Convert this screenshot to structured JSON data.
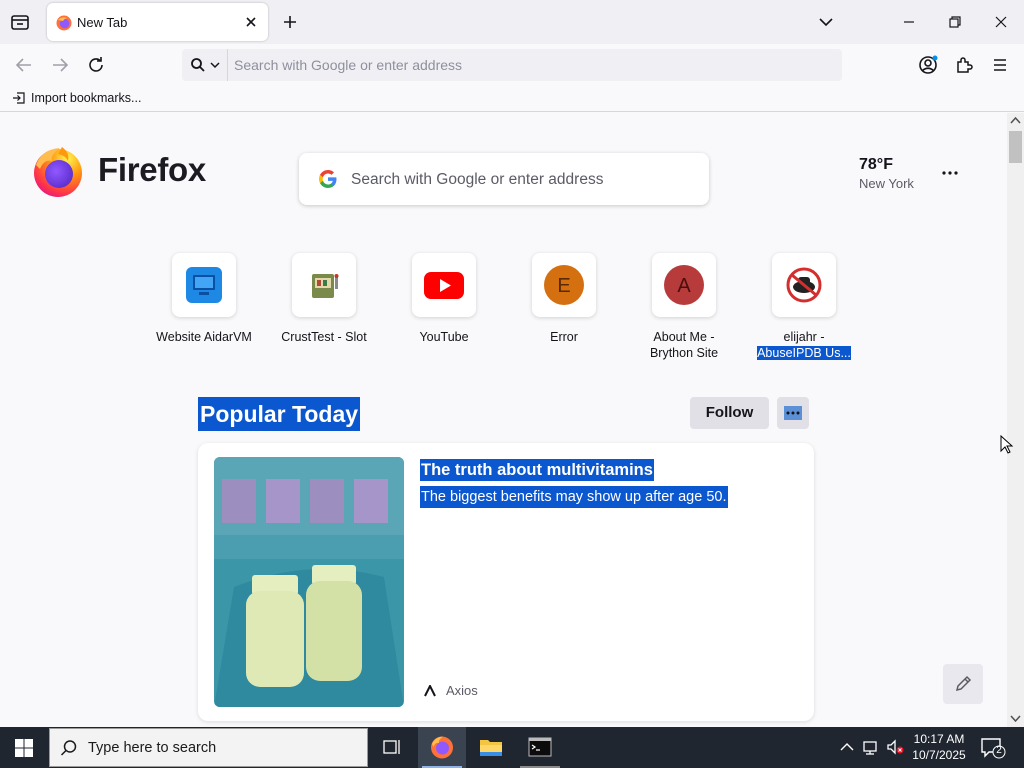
{
  "browser": {
    "tab": {
      "title": "New Tab"
    },
    "address_placeholder": "Search with Google or enter address",
    "bookmarks": {
      "import_label": "Import bookmarks..."
    }
  },
  "newtab": {
    "brand": "Firefox",
    "search_placeholder": "Search with Google or enter address",
    "weather": {
      "temp": "78°F",
      "city": "New York"
    },
    "top_sites": [
      {
        "label": "Website AidarVM",
        "icon": "monitor-icon"
      },
      {
        "label": "CrustTest - Slot",
        "icon": "slot-icon"
      },
      {
        "label": "YouTube",
        "icon": "youtube-icon"
      },
      {
        "label": "Error",
        "icon": "letter-e-icon",
        "letter": "E",
        "color": "#d4700f"
      },
      {
        "label_line1": "About Me -",
        "label_line2": "Brython Site",
        "icon": "letter-a-icon",
        "letter": "A",
        "color": "#b83b3b"
      },
      {
        "label_line1": "elijahr -",
        "label_line2": "AbuseIPDB Us...",
        "icon": "abuseipdb-icon"
      }
    ],
    "popular": {
      "title": "Popular Today",
      "follow_label": "Follow"
    },
    "story": {
      "headline": "The truth about multivitamins",
      "excerpt": "The biggest benefits may show up after age 50.",
      "source": "Axios"
    }
  },
  "taskbar": {
    "search_placeholder": "Type here to search",
    "time": "10:17 AM",
    "date": "10/7/2025",
    "notification_count": "2"
  },
  "colors": {
    "selection": "#0b57d0",
    "taskbar": "#1f2630",
    "accent": "#0060df"
  }
}
